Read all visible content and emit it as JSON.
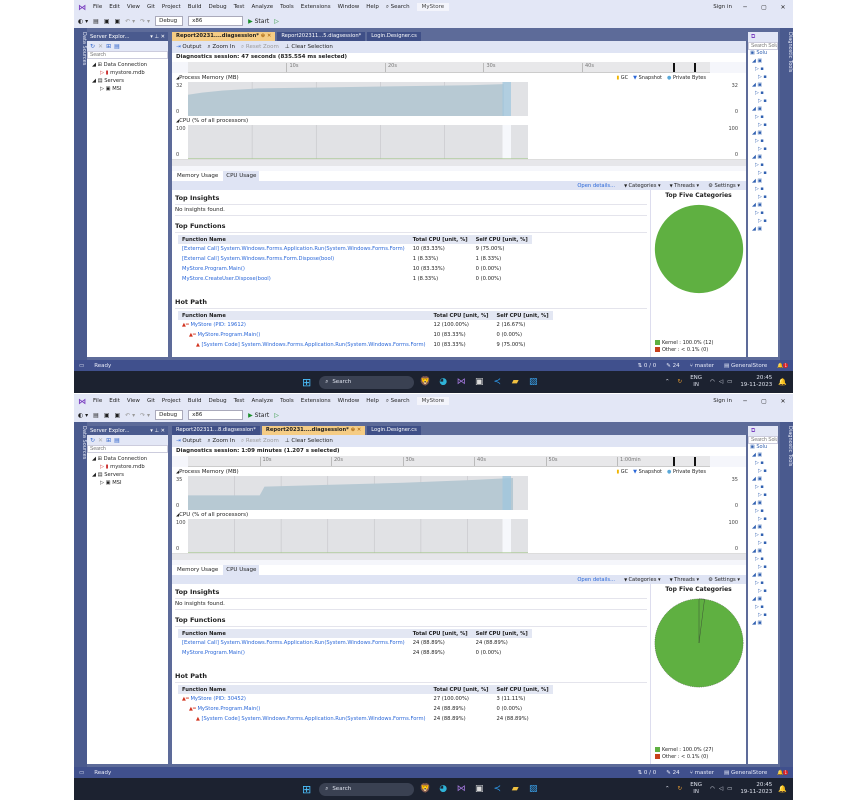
{
  "menu": [
    "File",
    "Edit",
    "View",
    "Git",
    "Project",
    "Build",
    "Debug",
    "Test",
    "Analyze",
    "Tools",
    "Extensions",
    "Window",
    "Help"
  ],
  "search_label": "Search",
  "solution_badge": "MyStore",
  "sign_in": "Sign in",
  "toolbar": {
    "config": "Debug",
    "platform": "x86",
    "start": "Start"
  },
  "left_strip": "Data Sources",
  "right_strip": "Diagnostic Tools",
  "server_explorer": {
    "title": "Server Explor...",
    "search_placeholder": "Search",
    "tree": [
      "Data Connection",
      "mystore.mdb",
      "Servers",
      "MSI"
    ]
  },
  "solution_explorer": {
    "search_placeholder": "Search Solu",
    "root": "Solu"
  },
  "doc_toolbar": {
    "output": "Output",
    "zoom_in": "Zoom In",
    "reset_zoom": "Reset Zoom",
    "clear_selection": "Clear Selection"
  },
  "legend": {
    "gc": "GC",
    "snapshot": "Snapshot",
    "private_bytes": "Private Bytes"
  },
  "labels": {
    "process_memory": "Process Memory (MB)",
    "cpu": "CPU (% of all processors)",
    "memory_usage_tab": "Memory Usage",
    "cpu_usage_tab": "CPU Usage",
    "open_details": "Open details...",
    "categories": "Categories",
    "threads": "Threads",
    "settings": "Settings",
    "top_insights": "Top Insights",
    "no_insights": "No insights found.",
    "top_functions": "Top Functions",
    "hot_path": "Hot Path",
    "function_name": "Function Name",
    "total_cpu": "Total CPU [unit, %]",
    "self_cpu": "Self CPU [unit, %]",
    "top_five": "Top Five Categories",
    "ready": "Ready"
  },
  "status": {
    "changes": "0 / 0",
    "edits": "24",
    "branch": "master",
    "repo": "GeneralStore",
    "notifications": "1"
  },
  "taskbar": {
    "search": "Search",
    "lang": "ENG",
    "region": "IN",
    "time": "20:45",
    "date": "19-11-2023"
  },
  "colors": {
    "accent": "#5d6b99",
    "active_tab": "#f5cc84",
    "kernel": "#5fb041",
    "other": "#c8401c",
    "memory": "#b7c9d3"
  },
  "windows": [
    {
      "tabs": [
        {
          "label": "Report20231....diagsession*",
          "active": true
        },
        {
          "label": "Report202311...5.diagsession*",
          "active": false
        },
        {
          "label": "Login.Designer.cs",
          "active": false
        }
      ],
      "session": "Diagnostics session: 47 seconds (835.554 ms selected)",
      "ruler": [
        "10s",
        "20s",
        "30s",
        "40s"
      ],
      "mem_max": "32",
      "mem_min": "0",
      "cpu_max": "100",
      "cpu_min": "0",
      "chart_data": {
        "type": "area",
        "title": "Process Memory (MB)",
        "x": [
          0,
          2,
          5,
          10,
          20,
          30,
          40,
          45
        ],
        "y": [
          20,
          22,
          24,
          26,
          27,
          28,
          29,
          30
        ],
        "ylim": [
          0,
          32
        ],
        "xlim": [
          0,
          47
        ]
      },
      "top_functions": [
        {
          "name": "[External Call] System.Windows.Forms.Application.Run(System.Windows.Forms.Form)",
          "total": "10 (83.33%)",
          "self": "9 (75.00%)"
        },
        {
          "name": "[External Call] System.Windows.Forms.Form.Dispose(bool)",
          "total": "1 (8.33%)",
          "self": "1 (8.33%)"
        },
        {
          "name": "MyStore.Program.Main()",
          "total": "10 (83.33%)",
          "self": "0 (0.00%)"
        },
        {
          "name": "MyStore.CreateUser.Dispose(bool)",
          "total": "1 (8.33%)",
          "self": "0 (0.00%)"
        }
      ],
      "hot_path": [
        {
          "name": "MyStore (PID: 19612)",
          "total": "12 (100.00%)",
          "self": "2 (16.67%)",
          "level": 0
        },
        {
          "name": "MyStore.Program.Main()",
          "total": "10 (83.33%)",
          "self": "0 (0.00%)",
          "level": 1
        },
        {
          "name": "[System Code] System.Windows.Forms.Application.Run(System.Windows.Forms.Form)",
          "total": "10 (83.33%)",
          "self": "9 (75.00%)",
          "level": 2
        }
      ],
      "pie": {
        "kernel": "Kernel : 100.0% (12)",
        "other": "Other : < 0.1% (0)",
        "kernel_pct": 100.0,
        "other_pct": 0.0
      }
    },
    {
      "tabs": [
        {
          "label": "Report202311...8.diagsession*",
          "active": false
        },
        {
          "label": "Report20231....diagsession*",
          "active": true
        },
        {
          "label": "Login.Designer.cs",
          "active": false
        }
      ],
      "session": "Diagnostics session: 1:09 minutes (1.207 s selected)",
      "ruler": [
        "10s",
        "20s",
        "30s",
        "40s",
        "50s",
        "1:00min"
      ],
      "mem_max": "35",
      "mem_min": "0",
      "cpu_max": "100",
      "cpu_min": "0",
      "chart_data": {
        "type": "area",
        "title": "Process Memory (MB)",
        "x": [
          0,
          15,
          16,
          30,
          45,
          60,
          68
        ],
        "y": [
          15,
          15,
          24,
          26,
          28,
          31,
          33
        ],
        "ylim": [
          0,
          35
        ],
        "xlim": [
          0,
          69
        ]
      },
      "top_functions": [
        {
          "name": "[External Call] System.Windows.Forms.Application.Run(System.Windows.Forms.Form)",
          "total": "24 (88.89%)",
          "self": "24 (88.89%)"
        },
        {
          "name": "MyStore.Program.Main()",
          "total": "24 (88.89%)",
          "self": "0 (0.00%)"
        }
      ],
      "hot_path": [
        {
          "name": "MyStore (PID: 30452)",
          "total": "27 (100.00%)",
          "self": "3 (11.11%)",
          "level": 0
        },
        {
          "name": "MyStore.Program.Main()",
          "total": "24 (88.89%)",
          "self": "0 (0.00%)",
          "level": 1
        },
        {
          "name": "[System Code] System.Windows.Forms.Application.Run(System.Windows.Forms.Form)",
          "total": "24 (88.89%)",
          "self": "24 (88.89%)",
          "level": 2
        }
      ],
      "pie": {
        "kernel": "Kernel : 100.0% (27)",
        "other": "Other : < 0.1% (0)",
        "kernel_pct": 99.5,
        "other_pct": 0.5
      }
    }
  ]
}
